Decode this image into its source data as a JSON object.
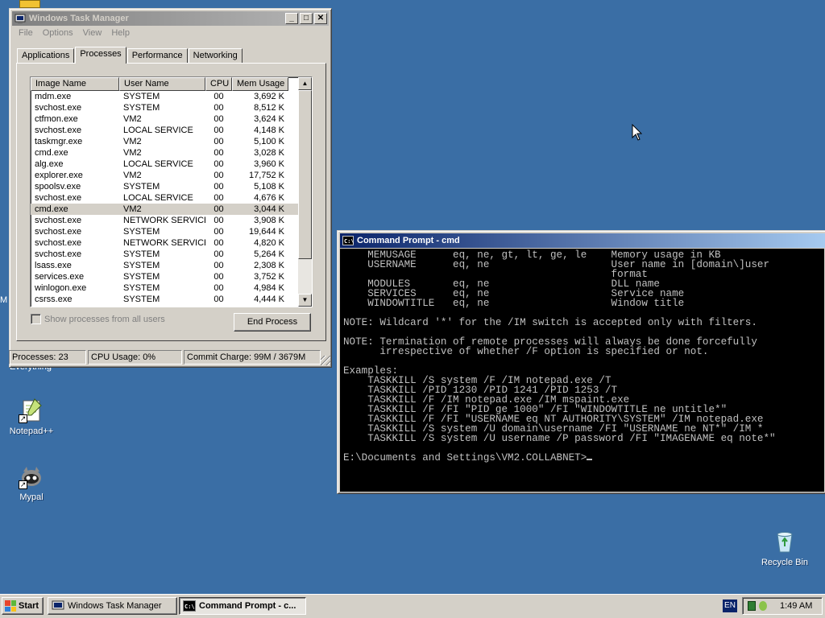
{
  "desktop": {
    "icons": [
      {
        "label": "Notepad++"
      },
      {
        "label": "Mypal"
      },
      {
        "label": "Recycle Bin"
      }
    ],
    "partial_labels": [
      "Everything",
      "M"
    ]
  },
  "task_manager": {
    "title": "Windows Task Manager",
    "menu": [
      "File",
      "Options",
      "View",
      "Help"
    ],
    "tabs": [
      "Applications",
      "Processes",
      "Performance",
      "Networking"
    ],
    "selected_tab": "Processes",
    "columns": [
      "Image Name",
      "User Name",
      "CPU",
      "Mem Usage"
    ],
    "processes": [
      {
        "name": "mdm.exe",
        "user": "SYSTEM",
        "cpu": "00",
        "mem": "3,692 K"
      },
      {
        "name": "svchost.exe",
        "user": "SYSTEM",
        "cpu": "00",
        "mem": "8,512 K"
      },
      {
        "name": "ctfmon.exe",
        "user": "VM2",
        "cpu": "00",
        "mem": "3,624 K"
      },
      {
        "name": "svchost.exe",
        "user": "LOCAL SERVICE",
        "cpu": "00",
        "mem": "4,148 K"
      },
      {
        "name": "taskmgr.exe",
        "user": "VM2",
        "cpu": "00",
        "mem": "5,100 K"
      },
      {
        "name": "cmd.exe",
        "user": "VM2",
        "cpu": "00",
        "mem": "3,028 K"
      },
      {
        "name": "alg.exe",
        "user": "LOCAL SERVICE",
        "cpu": "00",
        "mem": "3,960 K"
      },
      {
        "name": "explorer.exe",
        "user": "VM2",
        "cpu": "00",
        "mem": "17,752 K"
      },
      {
        "name": "spoolsv.exe",
        "user": "SYSTEM",
        "cpu": "00",
        "mem": "5,108 K"
      },
      {
        "name": "svchost.exe",
        "user": "LOCAL SERVICE",
        "cpu": "00",
        "mem": "4,676 K"
      },
      {
        "name": "cmd.exe",
        "user": "VM2",
        "cpu": "00",
        "mem": "3,044 K",
        "selected": true
      },
      {
        "name": "svchost.exe",
        "user": "NETWORK SERVICE",
        "cpu": "00",
        "mem": "3,908 K"
      },
      {
        "name": "svchost.exe",
        "user": "SYSTEM",
        "cpu": "00",
        "mem": "19,644 K"
      },
      {
        "name": "svchost.exe",
        "user": "NETWORK SERVICE",
        "cpu": "00",
        "mem": "4,820 K"
      },
      {
        "name": "svchost.exe",
        "user": "SYSTEM",
        "cpu": "00",
        "mem": "5,264 K"
      },
      {
        "name": "lsass.exe",
        "user": "SYSTEM",
        "cpu": "00",
        "mem": "2,308 K"
      },
      {
        "name": "services.exe",
        "user": "SYSTEM",
        "cpu": "00",
        "mem": "3,752 K"
      },
      {
        "name": "winlogon.exe",
        "user": "SYSTEM",
        "cpu": "00",
        "mem": "4,984 K"
      },
      {
        "name": "csrss.exe",
        "user": "SYSTEM",
        "cpu": "00",
        "mem": "4,444 K"
      }
    ],
    "show_all_label": "Show processes from all users",
    "end_process_label": "End Process",
    "status": {
      "processes": "Processes: 23",
      "cpu": "CPU Usage: 0%",
      "commit": "Commit Charge: 99M / 3679M"
    }
  },
  "command_prompt": {
    "title": "Command Prompt - cmd",
    "lines": [
      "    MEMUSAGE      eq, ne, gt, lt, ge, le    Memory usage in KB",
      "    USERNAME      eq, ne                    User name in [domain\\]user",
      "                                            format",
      "    MODULES       eq, ne                    DLL name",
      "    SERVICES      eq, ne                    Service name",
      "    WINDOWTITLE   eq, ne                    Window title",
      "",
      "NOTE: Wildcard '*' for the /IM switch is accepted only with filters.",
      "",
      "NOTE: Termination of remote processes will always be done forcefully",
      "      irrespective of whether /F option is specified or not.",
      "",
      "Examples:",
      "    TASKKILL /S system /F /IM notepad.exe /T",
      "    TASKKILL /PID 1230 /PID 1241 /PID 1253 /T",
      "    TASKKILL /F /IM notepad.exe /IM mspaint.exe",
      "    TASKKILL /F /FI \"PID ge 1000\" /FI \"WINDOWTITLE ne untitle*\"",
      "    TASKKILL /F /FI \"USERNAME eq NT AUTHORITY\\SYSTEM\" /IM notepad.exe",
      "    TASKKILL /S system /U domain\\username /FI \"USERNAME ne NT*\" /IM *",
      "    TASKKILL /S system /U username /P password /FI \"IMAGENAME eq note*\"",
      ""
    ],
    "prompt": "E:\\Documents and Settings\\VM2.COLLABNET>"
  },
  "taskbar": {
    "start_label": "Start",
    "buttons": [
      {
        "label": "Windows Task Manager",
        "icon": "task-manager-icon"
      },
      {
        "label": "Command Prompt - c...",
        "icon": "cmd-icon",
        "pressed": true
      }
    ],
    "language": "EN",
    "clock": "1:49 AM"
  },
  "colors": {
    "desktop": "#3a6ea5",
    "active_title": "#0a246a",
    "face": "#d4d0c8"
  }
}
